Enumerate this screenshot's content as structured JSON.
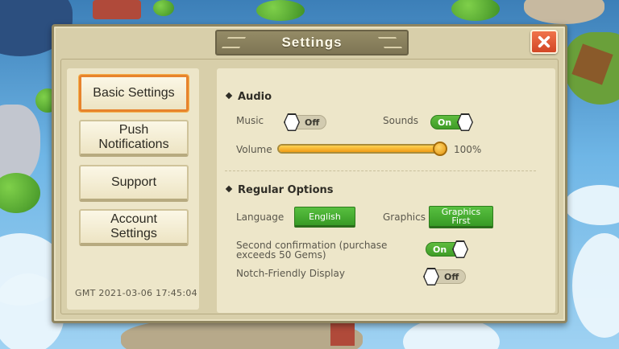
{
  "window": {
    "title": "Settings"
  },
  "nav": {
    "items": [
      {
        "label": "Basic Settings",
        "active": true
      },
      {
        "label": "Push Notifications",
        "active": false
      },
      {
        "label": "Support",
        "active": false
      },
      {
        "label": "Account Settings",
        "active": false
      }
    ],
    "timestamp": "GMT 2021-03-06 17:45:04"
  },
  "audio": {
    "heading": "Audio",
    "music": {
      "label": "Music",
      "state": "Off"
    },
    "sounds": {
      "label": "Sounds",
      "state": "On"
    },
    "volume": {
      "label": "Volume",
      "value_text": "100%",
      "value": 1.0
    }
  },
  "regular": {
    "heading": "Regular Options",
    "language": {
      "label": "Language",
      "value": "English"
    },
    "graphics": {
      "label": "Graphics",
      "value": "Graphics First"
    },
    "second_confirmation": {
      "label": "Second confirmation (purchase exceeds 50 Gems)",
      "state": "On"
    },
    "notch": {
      "label": "Notch-Friendly Display",
      "state": "Off"
    }
  },
  "colors": {
    "accent_orange": "#e7832d",
    "toggle_on_green": "#4aab30",
    "slider_fill": "#f5b52a",
    "close_red": "#e05a35"
  },
  "icons": {
    "close": "close-icon"
  }
}
